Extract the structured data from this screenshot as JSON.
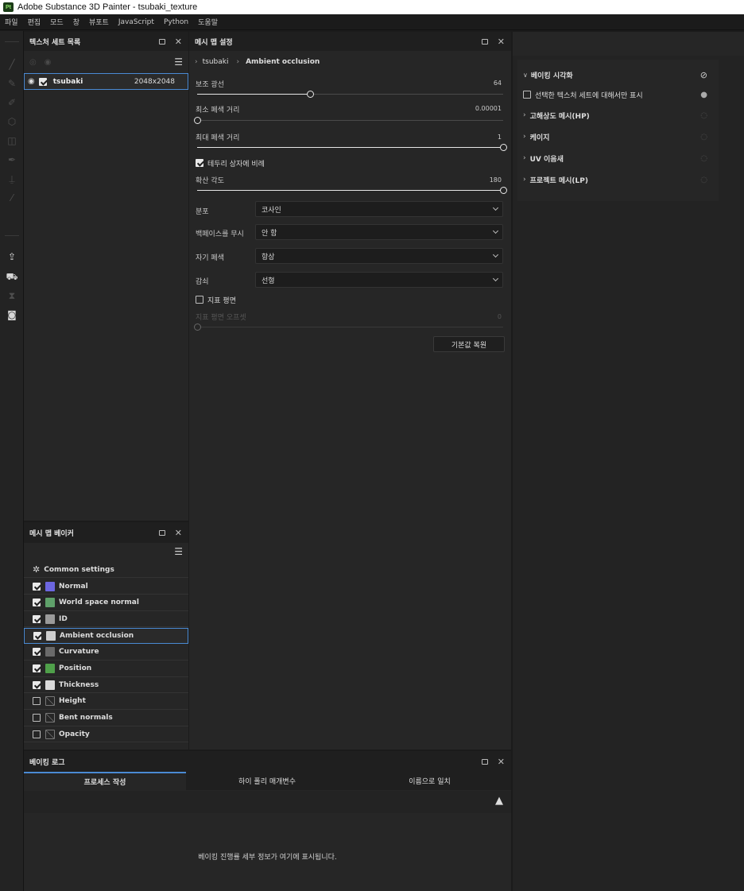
{
  "window": {
    "app_badge": "Pt",
    "title": "Adobe Substance 3D Painter - tsubaki_texture"
  },
  "menu": [
    "파일",
    "편집",
    "모드",
    "창",
    "뷰포트",
    "JavaScript",
    "Python",
    "도움말"
  ],
  "texture_set_panel": {
    "title": "텍스처 세트 목록",
    "items": [
      {
        "name": "tsubaki",
        "resolution": "2048x2048",
        "checked": true
      }
    ]
  },
  "bake_settings": {
    "title": "메시 맵 설정",
    "breadcrumb": [
      "tsubaki",
      "Ambient occlusion"
    ],
    "secondary_rays": {
      "label": "보조 광선",
      "value": "64",
      "fraction": 0.37
    },
    "min_occluder": {
      "label": "최소 폐색 거리",
      "value": "0.00001",
      "fraction": 0.0
    },
    "max_occluder": {
      "label": "최대 폐색 거리",
      "value": "1",
      "fraction": 1.0
    },
    "relative_to_bbox": {
      "label": "테두리 상자에 비례",
      "checked": true
    },
    "spread_angle": {
      "label": "확산 각도",
      "value": "180",
      "fraction": 1.0
    },
    "distribution": {
      "label": "분포",
      "value": "코사인"
    },
    "ignore_backface": {
      "label": "백페이스를 무시",
      "value": "안 함"
    },
    "self_occlusion": {
      "label": "자기 폐색",
      "value": "항상"
    },
    "attenuation": {
      "label": "감쇠",
      "value": "선형"
    },
    "ground_plane": {
      "label": "지표 평면",
      "checked": false
    },
    "ground_offset": {
      "label": "지표 평면 오프셋",
      "value": "0",
      "fraction": 0.0
    },
    "reset_button": "기본값 복원"
  },
  "baker_panel": {
    "title": "메시 맵 베이커",
    "common": "Common settings",
    "maps": [
      {
        "name": "Normal",
        "checked": true,
        "thumb": "#6c66e0"
      },
      {
        "name": "World space normal",
        "checked": true,
        "thumb": "#5fa06a"
      },
      {
        "name": "ID",
        "checked": true,
        "thumb": "#9a9a9a"
      },
      {
        "name": "Ambient occlusion",
        "checked": true,
        "thumb": "#cfcfcf",
        "selected": true
      },
      {
        "name": "Curvature",
        "checked": true,
        "thumb": "#6a6a6a"
      },
      {
        "name": "Position",
        "checked": true,
        "thumb": "#4fa04a"
      },
      {
        "name": "Thickness",
        "checked": true,
        "thumb": "#dadada"
      },
      {
        "name": "Height",
        "checked": false,
        "thumb": "none"
      },
      {
        "name": "Bent normals",
        "checked": false,
        "thumb": "none"
      },
      {
        "name": "Opacity",
        "checked": false,
        "thumb": "none"
      }
    ]
  },
  "bake_log": {
    "title": "베이킹 로그",
    "tabs": [
      "프로세스 작성",
      "하이 폴리 매개변수",
      "이름으로 일치"
    ],
    "message": "베이킹 진행률 세부 정보가 여기에 표시됩니다."
  },
  "visualization": {
    "title": "베이킹 시각화",
    "only_selected": "선택한 텍스처 세트에 대해서만 표시",
    "groups": [
      "고해상도 메시(HP)",
      "케이지",
      "UV 이음새",
      "프로젝트 메시(LP)"
    ]
  },
  "colors": {
    "accent": "#4a8ad3",
    "panel": "#262626",
    "header": "#1f1f1f"
  }
}
